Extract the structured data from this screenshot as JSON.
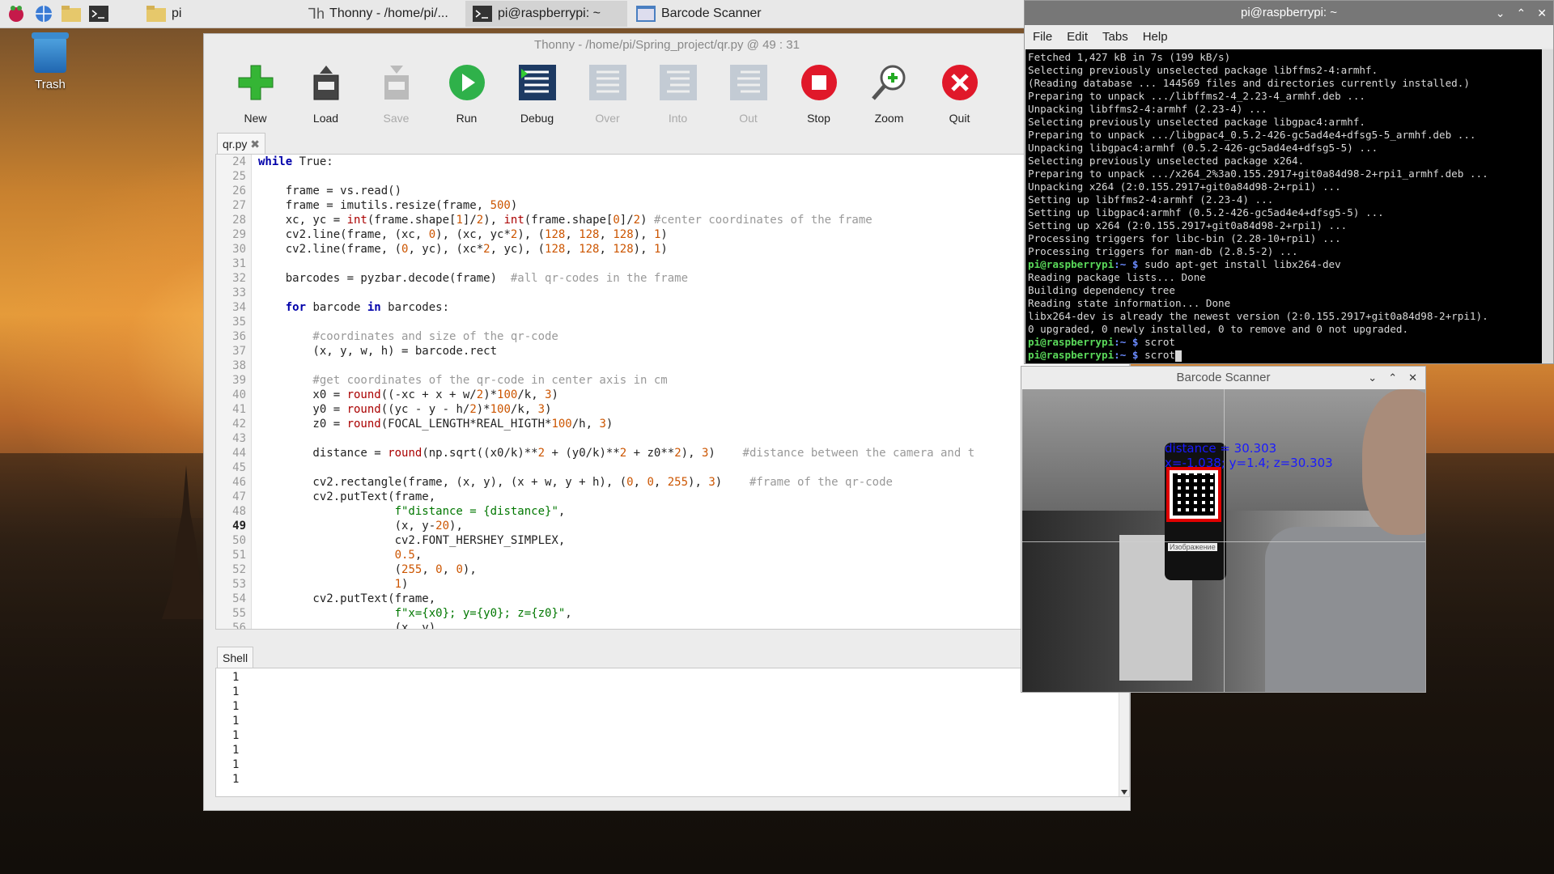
{
  "desktop": {
    "trash_label": "Trash"
  },
  "taskbar": {
    "folder_label": "pi",
    "tasks": [
      {
        "label": "Thonny  -  /home/pi/..."
      },
      {
        "label": "pi@raspberrypi: ~"
      },
      {
        "label": "Barcode Scanner"
      }
    ]
  },
  "thonny": {
    "title": "Thonny  -  /home/pi/Spring_project/qr.py  @  49 : 31",
    "toolbar": {
      "new": "New",
      "load": "Load",
      "save": "Save",
      "run": "Run",
      "debug": "Debug",
      "over": "Over",
      "into": "Into",
      "out": "Out",
      "stop": "Stop",
      "zoom": "Zoom",
      "quit": "Quit"
    },
    "editor_tab": "qr.py",
    "line_numbers": [
      "24",
      "25",
      "26",
      "27",
      "28",
      "29",
      "30",
      "31",
      "32",
      "33",
      "34",
      "35",
      "36",
      "37",
      "38",
      "39",
      "40",
      "41",
      "42",
      "43",
      "44",
      "45",
      "46",
      "47",
      "48",
      "49",
      "50",
      "51",
      "52",
      "53",
      "54",
      "55",
      "56"
    ],
    "current_line": "49",
    "shell_tab": "Shell",
    "shell_lines": [
      "1",
      "1",
      "1",
      "1",
      "1",
      "1",
      "1",
      "1"
    ]
  },
  "code": {
    "l24_kw": "while",
    "l24_rest": " True:",
    "l26": "    frame = vs.read()",
    "l27_a": "    frame = imutils.resize(frame, ",
    "l27_n": "500",
    "l27_b": ")",
    "l28_a": "    xc, yc = ",
    "l28_b1": "int",
    "l28_c": "(frame.shape[",
    "l28_n1": "1",
    "l28_d": "]/",
    "l28_n2": "2",
    "l28_e": "), ",
    "l28_b2": "int",
    "l28_f": "(frame.shape[",
    "l28_n3": "0",
    "l28_g": "]/",
    "l28_n4": "2",
    "l28_h": ") ",
    "l28_cm": "#center coordinates of the frame",
    "l29_a": "    cv2.line(frame, (xc, ",
    "l29_n1": "0",
    "l29_b": "), (xc, yc*",
    "l29_n2": "2",
    "l29_c": "), (",
    "l29_n3": "128",
    "l29_d": ", ",
    "l29_n4": "128",
    "l29_e": ", ",
    "l29_n5": "128",
    "l29_f": "), ",
    "l29_n6": "1",
    "l29_g": ")",
    "l30_a": "    cv2.line(frame, (",
    "l30_n1": "0",
    "l30_b": ", yc), (xc*",
    "l30_n2": "2",
    "l30_c": ", yc), (",
    "l30_n3": "128",
    "l30_d": ", ",
    "l30_n4": "128",
    "l30_e": ", ",
    "l30_n5": "128",
    "l30_f": "), ",
    "l30_n6": "1",
    "l30_g": ")",
    "l32_a": "    barcodes = pyzbar.decode(frame)  ",
    "l32_cm": "#all qr-codes in the frame",
    "l34_a": "    ",
    "l34_kw1": "for",
    "l34_b": " barcode ",
    "l34_kw2": "in",
    "l34_c": " barcodes:",
    "l36_cm": "        #coordinates and size of the qr-code",
    "l37": "        (x, y, w, h) = barcode.rect",
    "l39_cm": "        #get coordinates of the qr-code in center axis in cm",
    "l40_a": "        x0 = ",
    "l40_bi": "round",
    "l40_b": "((-xc + x + w/",
    "l40_n1": "2",
    "l40_c": ")*",
    "l40_n2": "100",
    "l40_d": "/k, ",
    "l40_n3": "3",
    "l40_e": ")",
    "l41_a": "        y0 = ",
    "l41_bi": "round",
    "l41_b": "((yc - y - h/",
    "l41_n1": "2",
    "l41_c": ")*",
    "l41_n2": "100",
    "l41_d": "/k, ",
    "l41_n3": "3",
    "l41_e": ")",
    "l42_a": "        z0 = ",
    "l42_bi": "round",
    "l42_b": "(FOCAL_LENGTH*REAL_HIGTH*",
    "l42_n1": "100",
    "l42_c": "/h, ",
    "l42_n2": "3",
    "l42_d": ")",
    "l44_a": "        distance = ",
    "l44_bi": "round",
    "l44_b": "(np.sqrt((x0/k)**",
    "l44_n1": "2",
    "l44_c": " + (y0/k)**",
    "l44_n2": "2",
    "l44_d": " + z0**",
    "l44_n3": "2",
    "l44_e": "), ",
    "l44_n4": "3",
    "l44_f": ")    ",
    "l44_cm": "#distance between the camera and t",
    "l46_a": "        cv2.rectangle(frame, (x, y), (x + w, y + h), (",
    "l46_n1": "0",
    "l46_b": ", ",
    "l46_n2": "0",
    "l46_c": ", ",
    "l46_n3": "255",
    "l46_d": "), ",
    "l46_n4": "3",
    "l46_e": ")    ",
    "l46_cm": "#frame of the qr-code",
    "l47": "        cv2.putText(frame,",
    "l48_a": "                    ",
    "l48_str": "f\"distance = {distance}\"",
    "l48_b": ",",
    "l49_a": "                    (x, y-",
    "l49_n": "20",
    "l49_b": "),",
    "l50": "                    cv2.FONT_HERSHEY_SIMPLEX,",
    "l51_a": "                    ",
    "l51_n": "0.5",
    "l51_b": ",",
    "l52_a": "                    (",
    "l52_n1": "255",
    "l52_b": ", ",
    "l52_n2": "0",
    "l52_c": ", ",
    "l52_n3": "0",
    "l52_d": "),",
    "l53_a": "                    ",
    "l53_n": "1",
    "l53_b": ")",
    "l54": "        cv2.putText(frame,",
    "l55_a": "                    ",
    "l55_str": "f\"x={x0}; y={y0}; z={z0}\"",
    "l55_b": ",",
    "l56": "                    (x, y)"
  },
  "terminal": {
    "title": "pi@raspberrypi: ~",
    "menu": [
      "File",
      "Edit",
      "Tabs",
      "Help"
    ],
    "lines": [
      "Fetched 1,427 kB in 7s (199 kB/s)",
      "Selecting previously unselected package libffms2-4:armhf.",
      "(Reading database ... 144569 files and directories currently installed.)",
      "Preparing to unpack .../libffms2-4_2.23-4_armhf.deb ...",
      "Unpacking libffms2-4:armhf (2.23-4) ...",
      "Selecting previously unselected package libgpac4:armhf.",
      "Preparing to unpack .../libgpac4_0.5.2-426-gc5ad4e4+dfsg5-5_armhf.deb ...",
      "Unpacking libgpac4:armhf (0.5.2-426-gc5ad4e4+dfsg5-5) ...",
      "Selecting previously unselected package x264.",
      "Preparing to unpack .../x264_2%3a0.155.2917+git0a84d98-2+rpi1_armhf.deb ...",
      "Unpacking x264 (2:0.155.2917+git0a84d98-2+rpi1) ...",
      "Setting up libffms2-4:armhf (2.23-4) ...",
      "Setting up libgpac4:armhf (0.5.2-426-gc5ad4e4+dfsg5-5) ...",
      "Setting up x264 (2:0.155.2917+git0a84d98-2+rpi1) ...",
      "Processing triggers for libc-bin (2.28-10+rpi1) ...",
      "Processing triggers for man-db (2.8.5-2) ..."
    ],
    "prompt_user": "pi@raspberrypi",
    "prompt_path": ":~ $",
    "cmd1": " sudo apt-get install libx264-dev",
    "lines2": [
      "Reading package lists... Done",
      "Building dependency tree",
      "Reading state information... Done",
      "libx264-dev is already the newest version (2:0.155.2917+git0a84d98-2+rpi1).",
      "0 upgraded, 0 newly installed, 0 to remove and 0 not upgraded."
    ],
    "cmd2": " scrot",
    "cmd3": " scrot"
  },
  "scanner": {
    "title": "Barcode Scanner",
    "overlay_distance": "distance = 30.303",
    "overlay_coords": "x=-1.038; y=1.4; z=30.303",
    "phone_text": "Изображение"
  }
}
